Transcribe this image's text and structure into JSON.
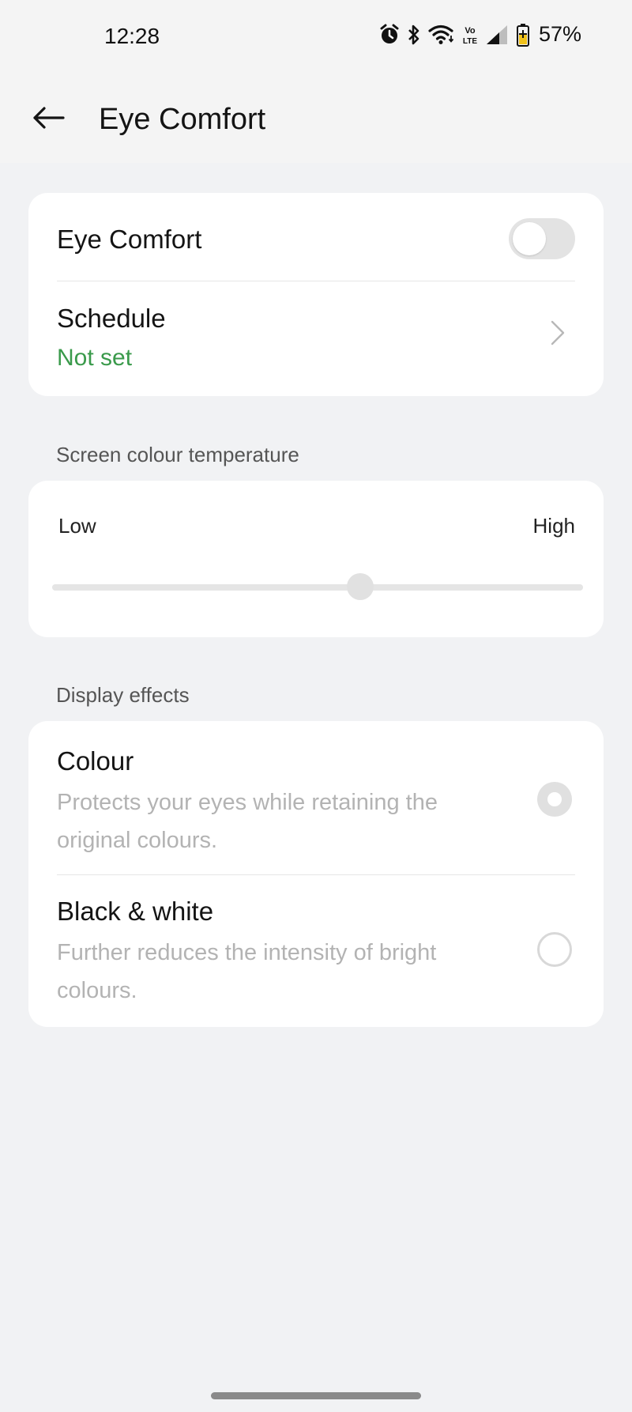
{
  "status_bar": {
    "time": "12:28",
    "battery": "57%",
    "icons": [
      "alarm-icon",
      "bluetooth-icon",
      "wifi-icon",
      "volte-icon",
      "signal-icon",
      "battery-icon"
    ]
  },
  "header": {
    "title": "Eye Comfort",
    "back_icon": "arrow-left-icon"
  },
  "eye_comfort": {
    "label": "Eye Comfort",
    "enabled": false
  },
  "schedule": {
    "label": "Schedule",
    "value": "Not set",
    "value_color": "#3a9a4b"
  },
  "temperature": {
    "section_label": "Screen colour temperature",
    "low_label": "Low",
    "high_label": "High",
    "value_fraction": 0.58
  },
  "display_effects": {
    "section_label": "Display effects",
    "options": [
      {
        "title": "Colour",
        "description": "Protects your eyes while retaining the original colours.",
        "selected": true
      },
      {
        "title": "Black & white",
        "description": "Further reduces the intensity of bright colours.",
        "selected": false
      }
    ]
  }
}
